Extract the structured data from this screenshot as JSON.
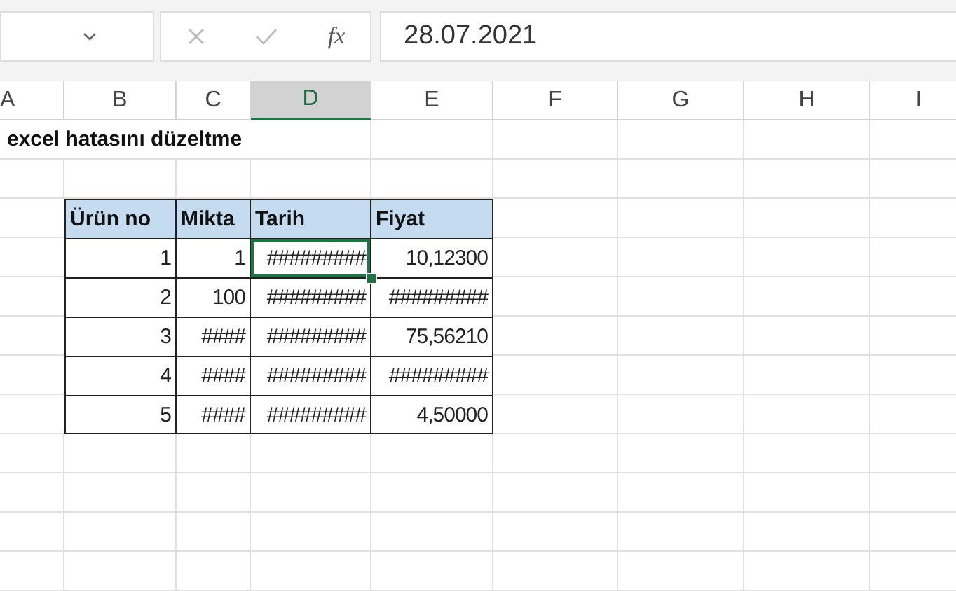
{
  "formula_bar": {
    "function_label": "fx",
    "formula": "28.07.2021"
  },
  "columns": [
    {
      "label": "A",
      "selected": false
    },
    {
      "label": "B",
      "selected": false
    },
    {
      "label": "C",
      "selected": false
    },
    {
      "label": "D",
      "selected": true
    },
    {
      "label": "E",
      "selected": false
    },
    {
      "label": "F",
      "selected": false
    },
    {
      "label": "G",
      "selected": false
    },
    {
      "label": "H",
      "selected": false
    },
    {
      "label": "I",
      "selected": false
    }
  ],
  "title": "excel hatasını düzeltme",
  "table": {
    "headers": [
      "Ürün no",
      "Mikta",
      "Tarih",
      "Fiyat"
    ],
    "rows": [
      {
        "cells": [
          {
            "text": "1",
            "selected": false
          },
          {
            "text": "1",
            "selected": false
          },
          {
            "text": "#########",
            "selected": true
          },
          {
            "text": "10,12300",
            "selected": false
          }
        ]
      },
      {
        "cells": [
          {
            "text": "2",
            "selected": false
          },
          {
            "text": "100",
            "selected": false
          },
          {
            "text": "#########",
            "selected": false
          },
          {
            "text": "#########",
            "selected": false
          }
        ]
      },
      {
        "cells": [
          {
            "text": "3",
            "selected": false
          },
          {
            "text": "####",
            "selected": false
          },
          {
            "text": "#########",
            "selected": false
          },
          {
            "text": "75,56210",
            "selected": false
          }
        ]
      },
      {
        "cells": [
          {
            "text": "4",
            "selected": false
          },
          {
            "text": "####",
            "selected": false
          },
          {
            "text": "#########",
            "selected": false
          },
          {
            "text": "#########",
            "selected": false
          }
        ]
      },
      {
        "cells": [
          {
            "text": "5",
            "selected": false
          },
          {
            "text": "####",
            "selected": false
          },
          {
            "text": "#########",
            "selected": false
          },
          {
            "text": "4,50000",
            "selected": false
          }
        ]
      }
    ]
  }
}
